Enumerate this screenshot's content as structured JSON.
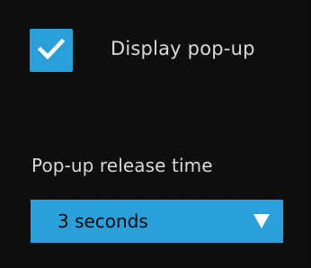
{
  "settings": {
    "display_popup": {
      "label": "Display pop-up",
      "checked": true
    },
    "release_time": {
      "label": "Pop-up release time",
      "selected": "3  seconds"
    }
  },
  "colors": {
    "background": "#0a0a0a",
    "accent": "#2a9fd8",
    "text": "#d9d9d9",
    "select_text": "#0d0d0d"
  },
  "icons": {
    "checkbox": "checkmark-icon",
    "dropdown": "triangle-down-icon"
  }
}
